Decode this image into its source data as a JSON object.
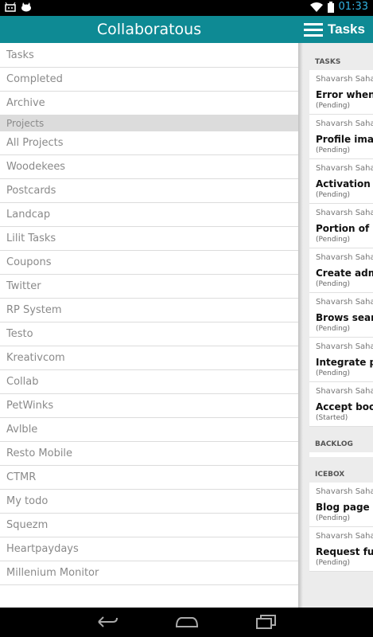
{
  "status_bar": {
    "time": "01:33",
    "icons": [
      "android-icon",
      "cat-icon",
      "wifi-icon",
      "battery-icon"
    ]
  },
  "drawer": {
    "title": "Collaboratous",
    "items_top": [
      "Tasks",
      "Completed",
      "Archive"
    ],
    "section_label": "Projects",
    "projects": [
      "All Projects",
      "Woodekees",
      "Postcards",
      "Landcap",
      "Lilit Tasks",
      "Coupons",
      "Twitter",
      "RP System",
      "Testo",
      "Kreativcom",
      "Collab",
      "PetWinks",
      "Avlble",
      "Resto Mobile",
      "CTMR",
      "My todo",
      "Squezm",
      "Heartpaydays",
      "Millenium Monitor"
    ]
  },
  "tasks_panel": {
    "title": "Tasks",
    "groups": [
      {
        "name": "TASKS",
        "tasks": [
          {
            "user": "Shavarsh Sahak",
            "title": "Error when su",
            "status": "(Pending)"
          },
          {
            "user": "Shavarsh Sahak",
            "title": "Profile image",
            "status": "(Pending)"
          },
          {
            "user": "Shavarsh Sahak",
            "title": "Activation em",
            "status": "(Pending)"
          },
          {
            "user": "Shavarsh Sahak",
            "title": "Portion of Pr",
            "status": "(Pending)"
          },
          {
            "user": "Shavarsh Sahak",
            "title": "Create admin",
            "status": "(Pending)"
          },
          {
            "user": "Shavarsh Sahak",
            "title": "Brows search",
            "status": "(Pending)"
          },
          {
            "user": "Shavarsh Sahak",
            "title": "Integrate pay",
            "status": "(Pending)"
          },
          {
            "user": "Shavarsh Sahak",
            "title": "Accept booki",
            "status": "(Started)"
          }
        ]
      },
      {
        "name": "BACKLOG",
        "tasks": []
      },
      {
        "name": "ICEBOX",
        "tasks": [
          {
            "user": "Shavarsh Sahak",
            "title": "Blog page",
            "status": "(Pending)"
          },
          {
            "user": "Shavarsh Sahak",
            "title": "Request fund",
            "status": "(Pending)"
          }
        ]
      }
    ]
  },
  "colors": {
    "header_teal": "#0e8a94",
    "status_blue": "#33b5e5"
  },
  "nav_icons": [
    "back-icon",
    "home-icon",
    "recent-apps-icon"
  ]
}
